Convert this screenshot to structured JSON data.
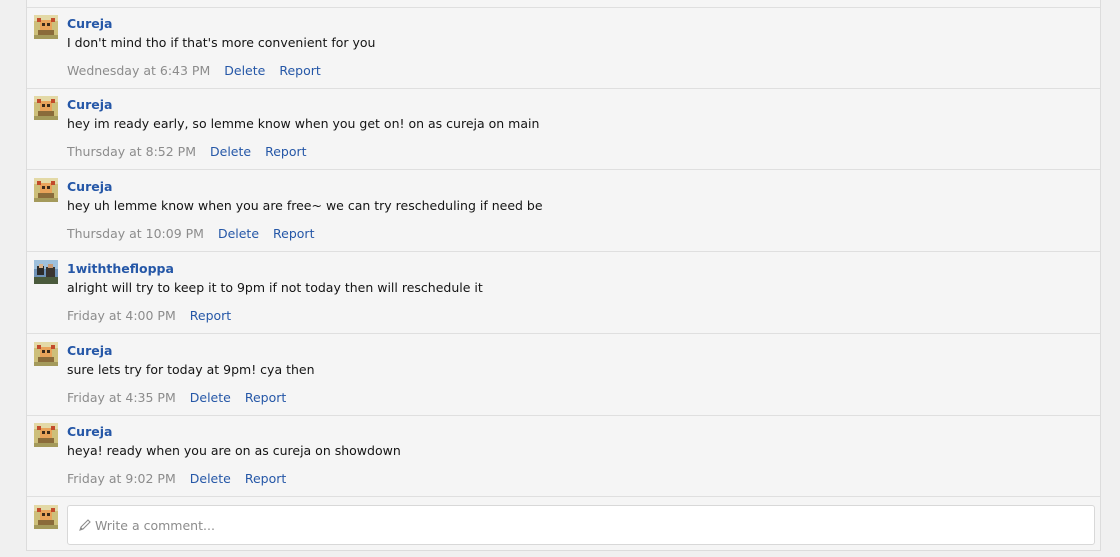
{
  "comments": [
    {
      "author": "Cureja",
      "avatar": "pixel-art-avatar-icon",
      "text": "I don't mind tho if that's more convenient for you",
      "time": "Wednesday at 6:43 PM",
      "delete": "Delete",
      "report": "Report"
    },
    {
      "author": "Cureja",
      "avatar": "pixel-art-avatar-icon",
      "text": "hey im ready early, so lemme know when you get on! on as cureja on main",
      "time": "Thursday at 8:52 PM",
      "delete": "Delete",
      "report": "Report"
    },
    {
      "author": "Cureja",
      "avatar": "pixel-art-avatar-icon",
      "text": "hey uh lemme know when you are free~ we can try rescheduling if need be",
      "time": "Thursday at 10:09 PM",
      "delete": "Delete",
      "report": "Report"
    },
    {
      "author": "1withthefloppa",
      "avatar": "photo-avatar-icon",
      "text": "alright will try to keep it to 9pm if not today then will reschedule it",
      "time": "Friday at 4:00 PM",
      "report": "Report"
    },
    {
      "author": "Cureja",
      "avatar": "pixel-art-avatar-icon",
      "text": "sure lets try for today at 9pm! cya then",
      "time": "Friday at 4:35 PM",
      "delete": "Delete",
      "report": "Report"
    },
    {
      "author": "Cureja",
      "avatar": "pixel-art-avatar-icon",
      "text": "heya! ready when you are on as cureja on showdown",
      "time": "Friday at 9:02 PM",
      "delete": "Delete",
      "report": "Report"
    }
  ],
  "composer": {
    "placeholder": "Write a comment...",
    "icon": "pencil-icon"
  },
  "colors": {
    "link": "#2557a7",
    "muted": "#8c8c8c",
    "background": "#f5f5f5"
  }
}
